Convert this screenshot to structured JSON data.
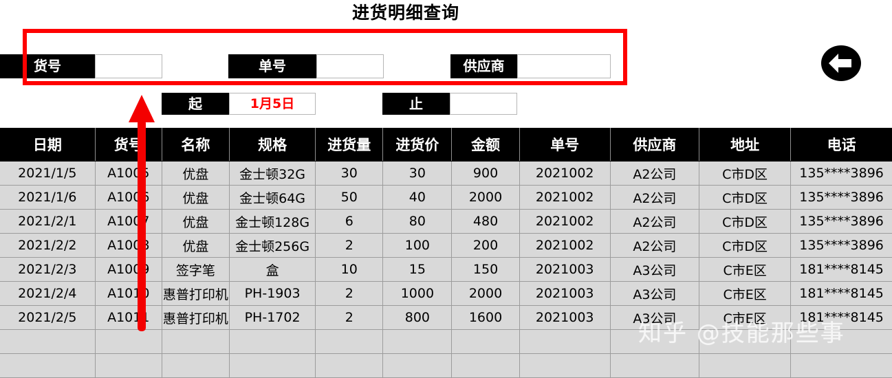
{
  "header": {
    "title": "进货明细查询",
    "back_button_icon": "arrow-left-circle-icon"
  },
  "filters": {
    "highlight_color": "#ff0000",
    "fields": [
      {
        "label": "货号",
        "value": "",
        "name": "item-code"
      },
      {
        "label": "单号",
        "value": "",
        "name": "order-no"
      },
      {
        "label": "供应商",
        "value": "",
        "name": "supplier"
      }
    ],
    "date_range": {
      "start_label": "起",
      "start_value": "1月5日",
      "end_label": "止",
      "end_value": ""
    }
  },
  "table": {
    "columns": [
      "日期",
      "货号",
      "名称",
      "规格",
      "进货量",
      "进货价",
      "金额",
      "单号",
      "供应商",
      "地址",
      "电话"
    ],
    "rows": [
      [
        "2021/1/5",
        "A1005",
        "优盘",
        "金士顿32G",
        "30",
        "30",
        "900",
        "2021002",
        "A2公司",
        "C市D区",
        "135****3896"
      ],
      [
        "2021/1/6",
        "A1006",
        "优盘",
        "金士顿64G",
        "50",
        "40",
        "2000",
        "2021002",
        "A2公司",
        "C市D区",
        "135****3896"
      ],
      [
        "2021/2/1",
        "A1007",
        "优盘",
        "金士顿128G",
        "6",
        "80",
        "480",
        "2021002",
        "A2公司",
        "C市D区",
        "135****3896"
      ],
      [
        "2021/2/2",
        "A1008",
        "优盘",
        "金士顿256G",
        "2",
        "100",
        "200",
        "2021002",
        "A2公司",
        "C市D区",
        "135****3896"
      ],
      [
        "2021/2/3",
        "A1009",
        "签字笔",
        "盒",
        "10",
        "15",
        "150",
        "2021003",
        "A3公司",
        "C市E区",
        "181****8145"
      ],
      [
        "2021/2/4",
        "A1010",
        "惠普打印机",
        "PH-1903",
        "2",
        "1000",
        "2000",
        "2021003",
        "A3公司",
        "C市E区",
        "181****8145"
      ],
      [
        "2021/2/5",
        "A1011",
        "惠普打印机",
        "PH-1702",
        "2",
        "800",
        "1600",
        "2021003",
        "A3公司",
        "C市E区",
        "181****8145"
      ],
      [
        "",
        "",
        "",
        "",
        "",
        "",
        "",
        "",
        "",
        "",
        ""
      ],
      [
        "",
        "",
        "",
        "",
        "",
        "",
        "",
        "",
        "",
        "",
        ""
      ]
    ]
  },
  "watermark": {
    "text": "知乎 @技能那些事"
  }
}
